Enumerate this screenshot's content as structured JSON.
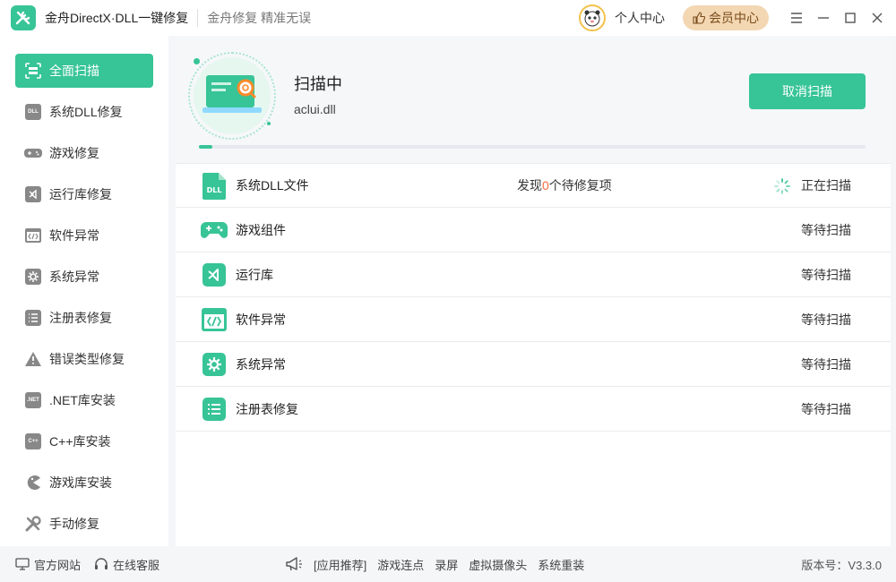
{
  "titlebar": {
    "app_title": "金舟DirectX·DLL一键修复",
    "slogan": "金舟修复 精准无误",
    "user_center": "个人中心",
    "vip_label": "会员中心"
  },
  "sidebar": {
    "items": [
      {
        "label": "全面扫描",
        "icon": "full-scan-icon"
      },
      {
        "label": "系统DLL修复",
        "icon": "dll-icon"
      },
      {
        "label": "游戏修复",
        "icon": "gamepad-icon"
      },
      {
        "label": "运行库修复",
        "icon": "runtime-icon"
      },
      {
        "label": "软件异常",
        "icon": "code-icon"
      },
      {
        "label": "系统异常",
        "icon": "gear-icon"
      },
      {
        "label": "注册表修复",
        "icon": "list-icon"
      },
      {
        "label": "错误类型修复",
        "icon": "warning-icon"
      },
      {
        "label": ".NET库安装",
        "icon": "net-icon"
      },
      {
        "label": "C++库安装",
        "icon": "cpp-icon"
      },
      {
        "label": "游戏库安装",
        "icon": "pacman-icon"
      },
      {
        "label": "手动修复",
        "icon": "wrench-icon"
      }
    ]
  },
  "scan": {
    "title": "扫描中",
    "current_file": "aclui.dll",
    "cancel_label": "取消扫描",
    "progress": 0.02
  },
  "scan_rows": [
    {
      "name": "系统DLL文件",
      "found_prefix": "发现",
      "found_count": "0",
      "found_suffix": "个待修复项",
      "status": "正在扫描"
    },
    {
      "name": "游戏组件",
      "status": "等待扫描"
    },
    {
      "name": "运行库",
      "status": "等待扫描"
    },
    {
      "name": "软件异常",
      "status": "等待扫描"
    },
    {
      "name": "系统异常",
      "status": "等待扫描"
    },
    {
      "name": "注册表修复",
      "status": "等待扫描"
    }
  ],
  "footer": {
    "website": "官方网站",
    "support": "在线客服",
    "recommend": [
      "[应用推荐]",
      "游戏连点",
      "录屏",
      "虚拟摄像头",
      "系统重装"
    ],
    "version": "版本号：V3.3.0"
  },
  "colors": {
    "accent": "#37c497",
    "highlight": "#ff6a3d",
    "vip_bg": "#f3d7b3"
  }
}
